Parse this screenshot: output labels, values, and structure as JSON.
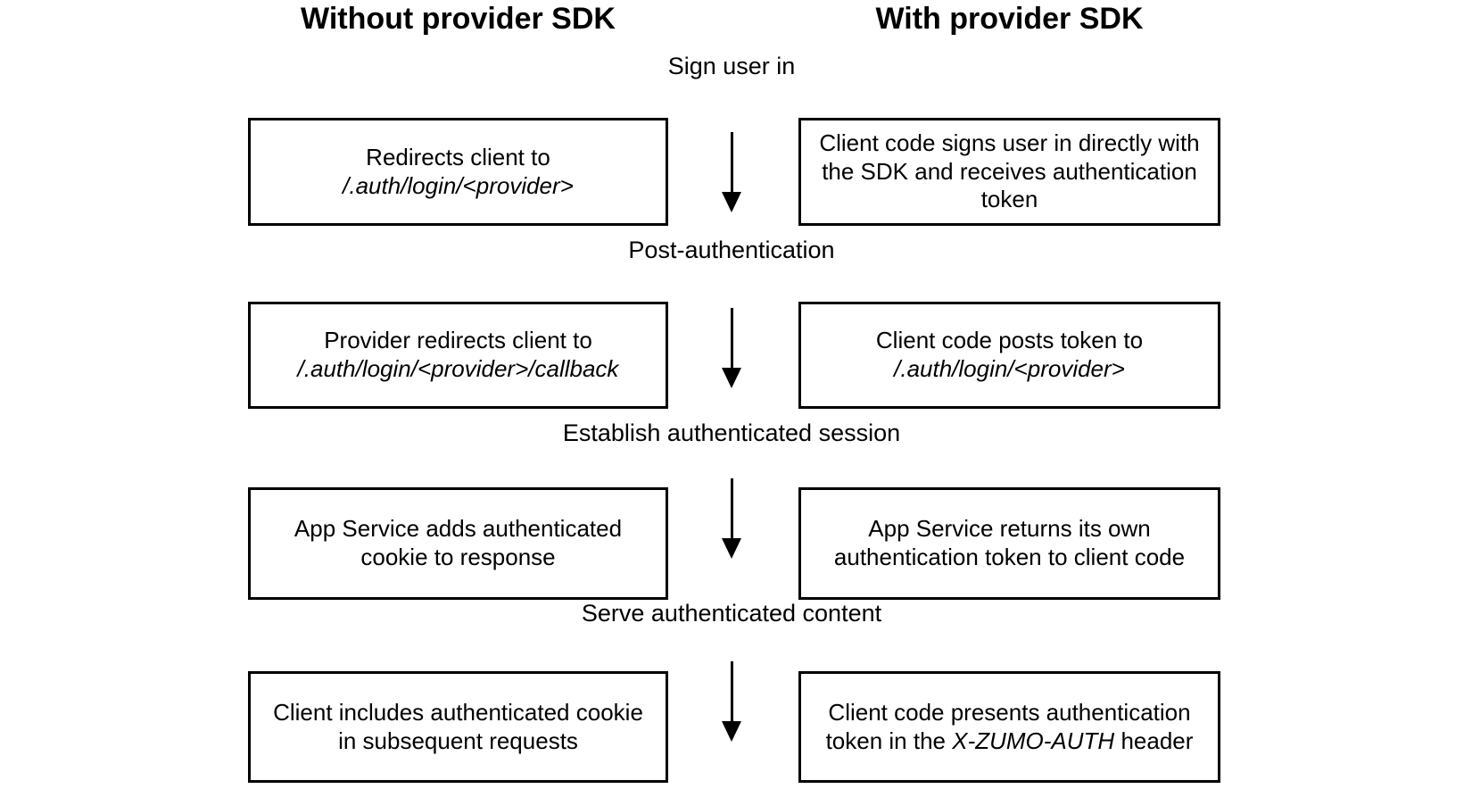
{
  "diagram": {
    "title_left": "Without provider SDK",
    "title_right": "With provider SDK",
    "steps": [
      {
        "label": "Sign user in",
        "left": "Redirects client to <em>/.auth/login/&lt;provider&gt;</em>",
        "right": "Client code signs user in directly with the SDK and receives authentication token",
        "arrow": "down-arrow"
      },
      {
        "label": "Post-authentication",
        "left": "Provider redirects client to <em>/.auth/login/&lt;provider&gt;/callback</em>",
        "right": "Client code posts token to <em>/.auth/login/&lt;provider&gt;</em>",
        "arrow": "down-arrow"
      },
      {
        "label": "Establish authenticated session",
        "left": "App Service adds authenticated cookie to response",
        "right": "App Service returns its own authentication token to client code",
        "arrow": "down-arrow"
      },
      {
        "label": "Serve authenticated content",
        "left": "Client includes authenticated cookie in subsequent requests",
        "right": "Client code presents authentication token in the <em>X-ZUMO-AUTH</em> header",
        "arrow": "down-arrow"
      }
    ],
    "colors": {
      "background": "#ffffff",
      "stroke": "#000000",
      "text": "#000000"
    }
  }
}
